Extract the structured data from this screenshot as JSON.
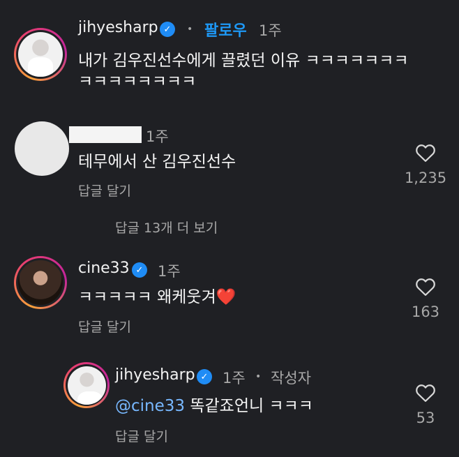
{
  "top_comment": {
    "username": "jihyesharp",
    "bullet": "•",
    "follow": "팔로우",
    "time": "1주",
    "text_line1": "내가 김우진선수에게 끌렸던 이유 ㅋㅋㅋㅋㅋㅋㅋ",
    "text_line2": "ㅋㅋㅋㅋㅋㅋㅋㅋ"
  },
  "comment2": {
    "time": "1주",
    "text": "테무에서 산 김우진선수",
    "reply_label": "답글 달기",
    "likes": "1,235"
  },
  "view_replies": "답글 13개 더 보기",
  "comment3": {
    "username": "cine33",
    "time": "1주",
    "text": "ㅋㅋㅋㅋㅋ 왜케웃겨",
    "emoji": "❤️",
    "reply_label": "답글 달기",
    "likes": "163"
  },
  "reply1": {
    "username": "jihyesharp",
    "time": "1주",
    "bullet": "•",
    "author_badge": "작성자",
    "mention": "@cine33",
    "text": " 똑같죠언니 ㅋㅋㅋ",
    "reply_label": "답글 달기",
    "likes": "53"
  },
  "colors": {
    "background": "#1f2024",
    "follow_blue": "#1e98f5",
    "verified_blue": "#1f8cf5",
    "mention_blue": "#78b8ff",
    "secondary_text": "#a8a8a8"
  }
}
